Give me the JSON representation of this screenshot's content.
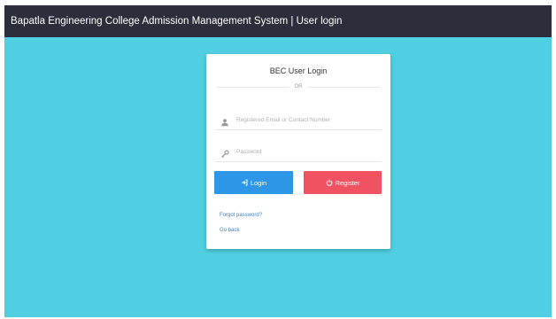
{
  "topbar": {
    "title": "Bapatla Engineering College Admission Management System | User login"
  },
  "login_card": {
    "title": "BEC User Login",
    "subtitle": "OR",
    "username_field": {
      "placeholder": "Registered Email or Contact Number",
      "value": "",
      "icon": "user-icon"
    },
    "password_field": {
      "placeholder": "Password",
      "value": "",
      "icon": "key-icon"
    },
    "login_button": {
      "label": "Login",
      "icon": "sign-in-icon",
      "color": "#2d96e6"
    },
    "register_button": {
      "label": "Register",
      "icon": "power-icon",
      "color": "#f15262"
    },
    "forgot_link": "Forgot password?",
    "back_link": "Go back"
  },
  "colors": {
    "background": "#4fcfe1",
    "topbar": "#2c2f3b",
    "card": "#ffffff"
  }
}
